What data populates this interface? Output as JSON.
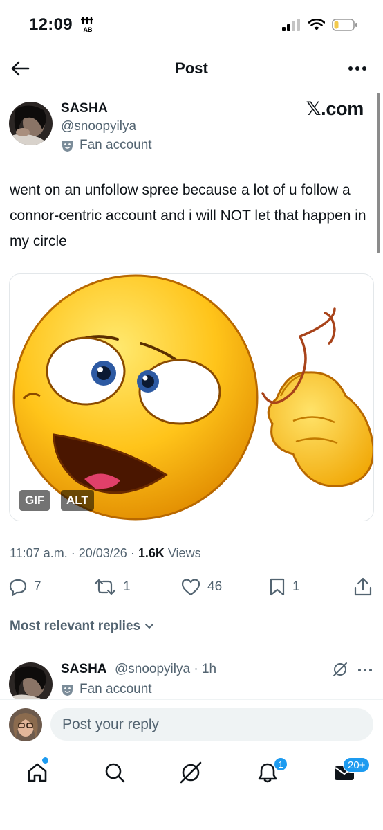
{
  "status_bar": {
    "time": "12:09",
    "icons": [
      "music-note-icon",
      "signal-bars-icon",
      "wifi-icon",
      "battery-icon"
    ]
  },
  "header": {
    "title": "Post",
    "back_icon": "arrow-left-icon",
    "more_icon": "more-horizontal-icon"
  },
  "post": {
    "author_name": "SASHA",
    "author_handle": "@snoopyilya",
    "badge": "Fan account",
    "watermark": "𝕏.com",
    "text": "went on an unfollow spree because a lot of u follow a connor-centric account and i will NOT let that happen in my circle",
    "media": {
      "type": "GIF",
      "gif_label": "GIF",
      "alt_label": "ALT",
      "description_icon": "confused-emoji-pointing-at-head"
    },
    "meta": {
      "time": "11:07 a.m.",
      "date": "20/03/26",
      "views_count": "1.6K",
      "views_label": "Views"
    },
    "actions": {
      "replies": "7",
      "reposts": "1",
      "likes": "46",
      "bookmarks": "1"
    }
  },
  "replies": {
    "sort_label": "Most relevant replies",
    "items": [
      {
        "name": "SASHA",
        "handle_time": "@snoopyilya · 1h",
        "badge": "Fan account"
      }
    ]
  },
  "compose": {
    "placeholder": "Post your reply"
  },
  "tabbar": {
    "notifications_badge": "1",
    "messages_badge": "20+"
  },
  "colors": {
    "accent": "#1d9bf0",
    "text": "#0f1419",
    "secondary": "#536471",
    "divider": "#eff3f4"
  }
}
